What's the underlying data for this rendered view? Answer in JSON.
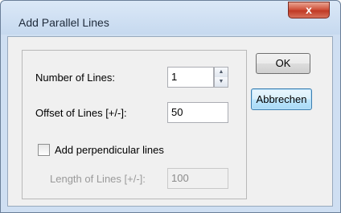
{
  "window": {
    "title": "Add Parallel Lines",
    "close_glyph": "x"
  },
  "form": {
    "number_of_lines": {
      "label": "Number of Lines:",
      "value": "1",
      "spin_up_glyph": "▲",
      "spin_down_glyph": "▼"
    },
    "offset_of_lines": {
      "label": "Offset of Lines [+/-]:",
      "value": "50"
    },
    "add_perpendicular": {
      "label": "Add perpendicular lines",
      "checked": false
    },
    "length_of_lines": {
      "label": "Length of Lines [+/-]:",
      "value": "100",
      "enabled": false
    }
  },
  "buttons": {
    "ok_label": "OK",
    "cancel_label": "Abbrechen"
  },
  "colors": {
    "frame": "#cfdff2",
    "close_button": "#c7432e",
    "client_bg": "#f0f0f0",
    "default_button_border": "#3c7fb1",
    "disabled_text": "#9a9a9a"
  },
  "icons": {
    "close": "close-icon",
    "spin_up": "arrow-up-icon",
    "spin_down": "arrow-down-icon"
  }
}
